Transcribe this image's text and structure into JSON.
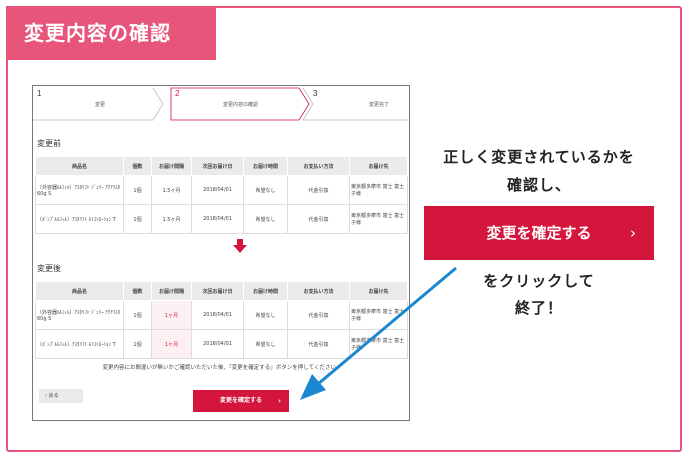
{
  "title": "変更内容の確認",
  "steps": [
    {
      "num": "1",
      "label": "変更"
    },
    {
      "num": "2",
      "label": "変更内容の確認"
    },
    {
      "num": "3",
      "label": "変更完了"
    }
  ],
  "before": {
    "heading": "変更前",
    "headers": [
      "商品名",
      "個数",
      "お届け間隔",
      "次回お届け日",
      "お届け時間",
      "お支払い方法",
      "お届け先"
    ],
    "rows": [
      [
        "〔外容器ﾙﾙﾌｨﾙ〕ｱｽﾀﾘﾌﾄ ｼﾞｪﾘｰ ｱｸｱﾘｽﾀ 60g S",
        "1個",
        "1.5ヶ月",
        "2018/04/01",
        "希望なし",
        "代金引換",
        "東京都多摩市 富士 富士子様"
      ],
      [
        "〔ﾎﾞﾝﾌﾟﾙﾙﾌｨﾙ〕ｱｽﾀﾘﾌﾄ ﾓｲｽﾄﾛｰｼｮﾝ T",
        "1個",
        "1.5ヶ月",
        "2018/04/01",
        "希望なし",
        "代金引換",
        "東京都多摩市 富士 富士子様"
      ]
    ]
  },
  "after": {
    "heading": "変更後",
    "headers": [
      "商品名",
      "個数",
      "お届け間隔",
      "次回お届け日",
      "お届け時間",
      "お支払い方法",
      "お届け先"
    ],
    "rows": [
      [
        "〔外容器ﾙﾙﾌｨﾙ〕ｱｽﾀﾘﾌﾄ ｼﾞｪﾘｰ ｱｸｱﾘｽﾀ 60g S",
        "1個",
        "1ヶ月",
        "2018/04/01",
        "希望なし",
        "代金引換",
        "東京都多摩市 富士 富士子様"
      ],
      [
        "〔ﾎﾞﾝﾌﾟﾙﾙﾌｨﾙ〕ｱｽﾀﾘﾌﾄ ﾓｲｽﾄﾛｰｼｮﾝ T",
        "1個",
        "1ヶ月",
        "2018/04/01",
        "希望なし",
        "代金引換",
        "東京都多摩市 富士 富士子様"
      ]
    ]
  },
  "note": "変更内容にお間違いが無いかご確認いただいた後、「変更を確定する」ボタンを押してください。",
  "back_label": "戻る",
  "confirm_label": "変更を確定する",
  "side": {
    "line1": "正しく変更されているかを",
    "line2": "確認し、",
    "button": "変更を確定する",
    "line3": "をクリックして",
    "line4": "終了！"
  },
  "colors": {
    "accent": "#d4153c",
    "tab_pink": "#e8557a",
    "arrow_blue": "#1a87d0"
  }
}
